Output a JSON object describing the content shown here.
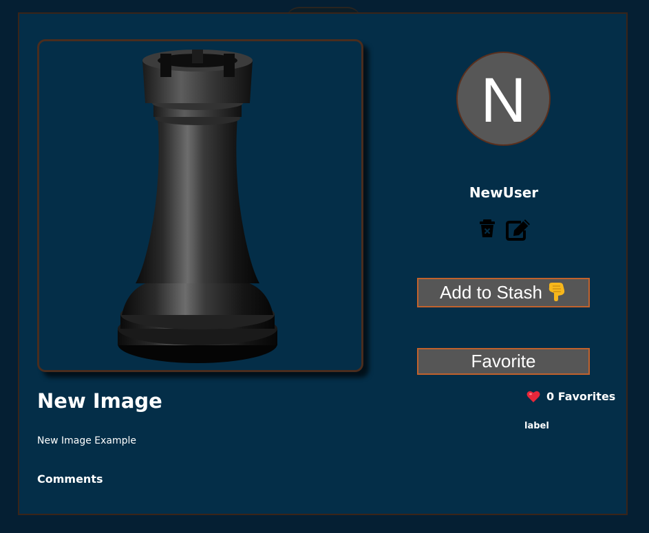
{
  "post": {
    "title": "New Image",
    "description": "New Image Example",
    "comments_heading": "Comments",
    "image_subject": "chess rook"
  },
  "user": {
    "avatar_initial": "N",
    "username": "NewUser"
  },
  "actions": {
    "delete_icon": "trash-icon",
    "edit_icon": "edit-icon",
    "stash_label": "Add to Stash",
    "stash_emoji": "pointing-down-hand",
    "favorite_label": "Favorite"
  },
  "favorites": {
    "count_text": "0 Favorites"
  },
  "label_text": "label",
  "colors": {
    "page_bg": "#051f33",
    "card_bg": "#042e48",
    "button_bg": "#565656",
    "button_border": "#c2622c",
    "avatar_bg": "#575757",
    "heart": "#e8273a"
  }
}
